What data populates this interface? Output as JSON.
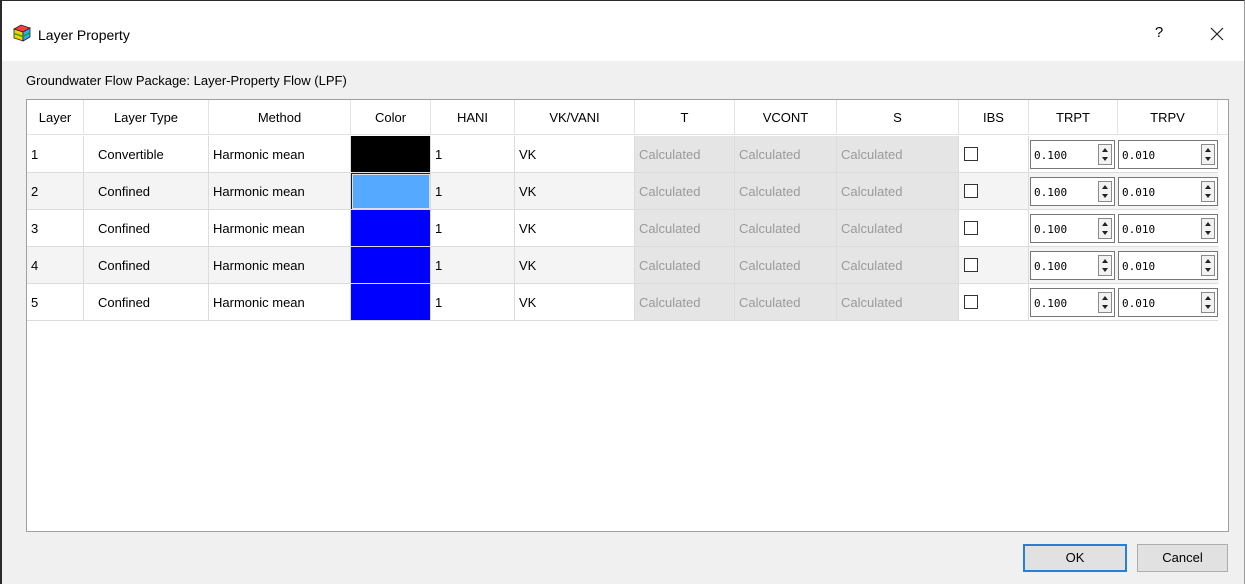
{
  "window": {
    "title": "Layer Property",
    "help_glyph": "?",
    "close_glyph": "✕",
    "icon": "layer-cube-icon"
  },
  "group_label": "Groundwater Flow Package: Layer-Property Flow (LPF)",
  "table": {
    "columns": [
      "Layer",
      "Layer Type",
      "Method",
      "Color",
      "HANI",
      "VK/VANI",
      "T",
      "VCONT",
      "S",
      "IBS",
      "TRPT",
      "TRPV"
    ],
    "rows": [
      {
        "layer": "1",
        "layer_type": "Convertible",
        "method": "Harmonic mean",
        "color": "#000000",
        "hani": "1",
        "vk_vani": "VK",
        "t": "Calculated",
        "vcont": "Calculated",
        "s": "Calculated",
        "ibs": false,
        "trpt": "0.100",
        "trpv": "0.010"
      },
      {
        "layer": "2",
        "layer_type": "Confined",
        "method": "Harmonic mean",
        "color": "#55aaff",
        "hani": "1",
        "vk_vani": "VK",
        "t": "Calculated",
        "vcont": "Calculated",
        "s": "Calculated",
        "ibs": false,
        "trpt": "0.100",
        "trpv": "0.010"
      },
      {
        "layer": "3",
        "layer_type": "Confined",
        "method": "Harmonic mean",
        "color": "#0000ff",
        "hani": "1",
        "vk_vani": "VK",
        "t": "Calculated",
        "vcont": "Calculated",
        "s": "Calculated",
        "ibs": false,
        "trpt": "0.100",
        "trpv": "0.010"
      },
      {
        "layer": "4",
        "layer_type": "Confined",
        "method": "Harmonic mean",
        "color": "#0000ff",
        "hani": "1",
        "vk_vani": "VK",
        "t": "Calculated",
        "vcont": "Calculated",
        "s": "Calculated",
        "ibs": false,
        "trpt": "0.100",
        "trpv": "0.010"
      },
      {
        "layer": "5",
        "layer_type": "Confined",
        "method": "Harmonic mean",
        "color": "#0000ff",
        "hani": "1",
        "vk_vani": "VK",
        "t": "Calculated",
        "vcont": "Calculated",
        "s": "Calculated",
        "ibs": false,
        "trpt": "0.100",
        "trpv": "0.010"
      }
    ]
  },
  "buttons": {
    "ok": "OK",
    "cancel": "Cancel"
  }
}
